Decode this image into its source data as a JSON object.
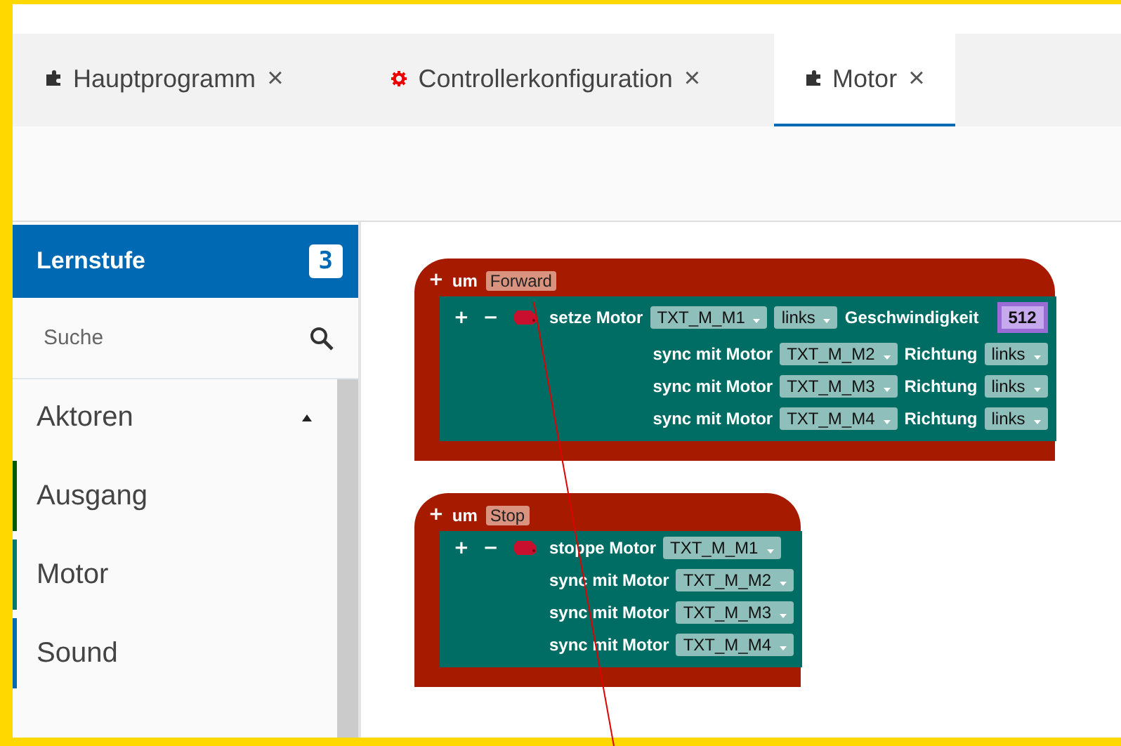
{
  "tabs": [
    {
      "label": "Hauptprogramm",
      "kind": "program",
      "close": "×",
      "selected": false
    },
    {
      "label": "Controllerkonfiguration",
      "kind": "config",
      "close": "×",
      "selected": false
    },
    {
      "label": "Motor",
      "kind": "program",
      "close": "×",
      "selected": true
    }
  ],
  "sidebar": {
    "title": "Lernstufe",
    "level_badge": "3",
    "search": {
      "placeholder": "Suche"
    },
    "category": {
      "label": "Aktoren",
      "expanded": true
    },
    "items": [
      {
        "label": "Ausgang",
        "color": "#005a00"
      },
      {
        "label": "Motor",
        "color": "#00796b"
      },
      {
        "label": "Sound",
        "color": "#0069b4"
      }
    ]
  },
  "blocks": [
    {
      "add": "+",
      "prefix": "um",
      "name": "Forward",
      "statements": [
        {
          "kind": "set",
          "add": "+",
          "remove": "−",
          "label": "setze Motor",
          "motor": "TXT_M_M1",
          "direction": "links",
          "speed_label": "Geschwindigkeit",
          "speed": "512"
        },
        {
          "kind": "sync",
          "label": "sync mit Motor",
          "motor": "TXT_M_M2",
          "direction_label": "Richtung",
          "direction": "links"
        },
        {
          "kind": "sync",
          "label": "sync mit Motor",
          "motor": "TXT_M_M3",
          "direction_label": "Richtung",
          "direction": "links"
        },
        {
          "kind": "sync",
          "label": "sync mit Motor",
          "motor": "TXT_M_M4",
          "direction_label": "Richtung",
          "direction": "links"
        }
      ]
    },
    {
      "add": "+",
      "prefix": "um",
      "name": "Stop",
      "statements": [
        {
          "kind": "stop",
          "add": "+",
          "remove": "−",
          "label": "stoppe Motor",
          "motor": "TXT_M_M1"
        },
        {
          "kind": "sync",
          "label": "sync mit Motor",
          "motor": "TXT_M_M2"
        },
        {
          "kind": "sync",
          "label": "sync mit Motor",
          "motor": "TXT_M_M3"
        },
        {
          "kind": "sync",
          "label": "sync mit Motor",
          "motor": "TXT_M_M4"
        }
      ]
    }
  ]
}
